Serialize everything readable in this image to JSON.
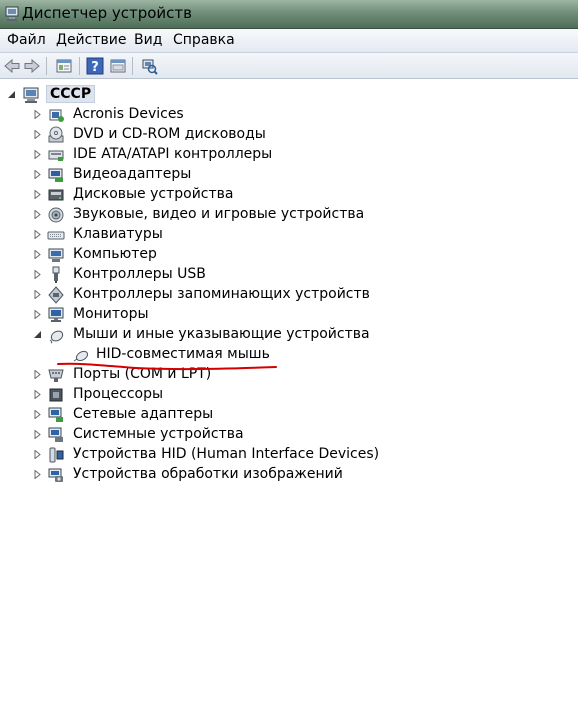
{
  "window": {
    "title": "Диспетчер устройств"
  },
  "menu": [
    "Файл",
    "Действие",
    "Вид",
    "Справка"
  ],
  "toolbar": {
    "buttons": [
      "back-arrow-icon",
      "forward-arrow-icon",
      "properties-icon",
      "help-icon",
      "view-icon",
      "scan-hardware-icon"
    ]
  },
  "tree": {
    "root": {
      "label": "СССР",
      "expanded": true
    },
    "items": [
      {
        "label": "Acronis Devices",
        "icon": "acronis-icon",
        "expanded": false
      },
      {
        "label": "DVD и CD-ROM дисководы",
        "icon": "dvd-icon",
        "expanded": false
      },
      {
        "label": "IDE ATA/ATAPI контроллеры",
        "icon": "ide-icon",
        "expanded": false
      },
      {
        "label": "Видеоадаптеры",
        "icon": "display-adapter-icon",
        "expanded": false
      },
      {
        "label": "Дисковые устройства",
        "icon": "disk-drive-icon",
        "expanded": false
      },
      {
        "label": "Звуковые, видео и игровые устройства",
        "icon": "sound-icon",
        "expanded": false
      },
      {
        "label": "Клавиатуры",
        "icon": "keyboard-icon",
        "expanded": false
      },
      {
        "label": "Компьютер",
        "icon": "computer-icon",
        "expanded": false
      },
      {
        "label": "Контроллеры USB",
        "icon": "usb-icon",
        "expanded": false
      },
      {
        "label": "Контроллеры запоминающих устройств",
        "icon": "storage-controller-icon",
        "expanded": false
      },
      {
        "label": "Мониторы",
        "icon": "monitor-icon",
        "expanded": false
      },
      {
        "label": "Мыши и иные указывающие устройства",
        "icon": "mouse-icon",
        "expanded": true,
        "children": [
          {
            "label": "HID-совместимая мышь",
            "icon": "mouse-icon"
          }
        ]
      },
      {
        "label": "Порты (COM и LPT)",
        "icon": "port-icon",
        "expanded": false
      },
      {
        "label": "Процессоры",
        "icon": "processor-icon",
        "expanded": false
      },
      {
        "label": "Сетевые адаптеры",
        "icon": "network-adapter-icon",
        "expanded": false
      },
      {
        "label": "Системные устройства",
        "icon": "system-devices-icon",
        "expanded": false
      },
      {
        "label": "Устройства HID (Human Interface Devices)",
        "icon": "hid-icon",
        "expanded": false
      },
      {
        "label": "Устройства обработки изображений",
        "icon": "imaging-icon",
        "expanded": false
      }
    ]
  },
  "annotation_color": "#d40000"
}
